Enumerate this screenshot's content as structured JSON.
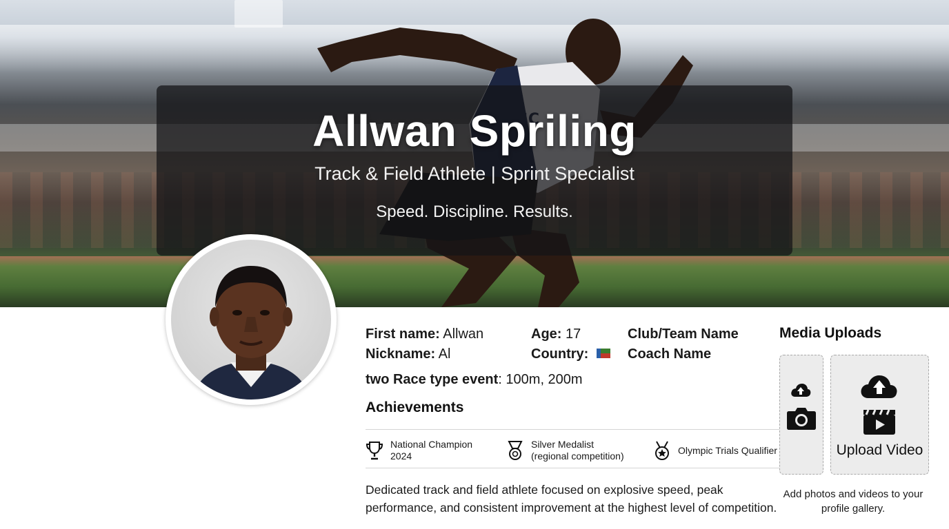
{
  "hero": {
    "name": "Allwan Spriling",
    "subtitle": "Track & Field Athlete | Sprint Specialist",
    "tagline": "Speed. Discipline. Results."
  },
  "profile": {
    "first_name_label": "First name:",
    "first_name": "Allwan",
    "nickname_label": "Nickname:",
    "nickname": "Al",
    "age_label": "Age:",
    "age": "17",
    "country_label": "Country:",
    "country_flag_colors": [
      "#3b7d2f",
      "#c0392b"
    ],
    "club_team_label": "Club/Team Name",
    "coach_label": "Coach Name",
    "events_label": "two Race type event",
    "events_value": ": 100m, 200m"
  },
  "achievements": {
    "title": "Achievements",
    "items": [
      {
        "icon": "trophy-icon",
        "line1": "National Champion",
        "line2": "2024"
      },
      {
        "icon": "medal-icon",
        "line1": "Silver Medalist",
        "line2": "(regional competition)"
      },
      {
        "icon": "medal-badge-icon",
        "line1": "Olympic Trials Qualifier",
        "line2": ""
      }
    ]
  },
  "bio": {
    "line1": "Dedicated track and field athlete focused on explosive speed, peak",
    "line2": "performance, and consistent improvement at the highest level of competition."
  },
  "media": {
    "title": "Media Uploads",
    "upload_video_label": "Upload Video",
    "help_line1": "Add photos and videos to your",
    "help_line2": "profile gallery."
  }
}
